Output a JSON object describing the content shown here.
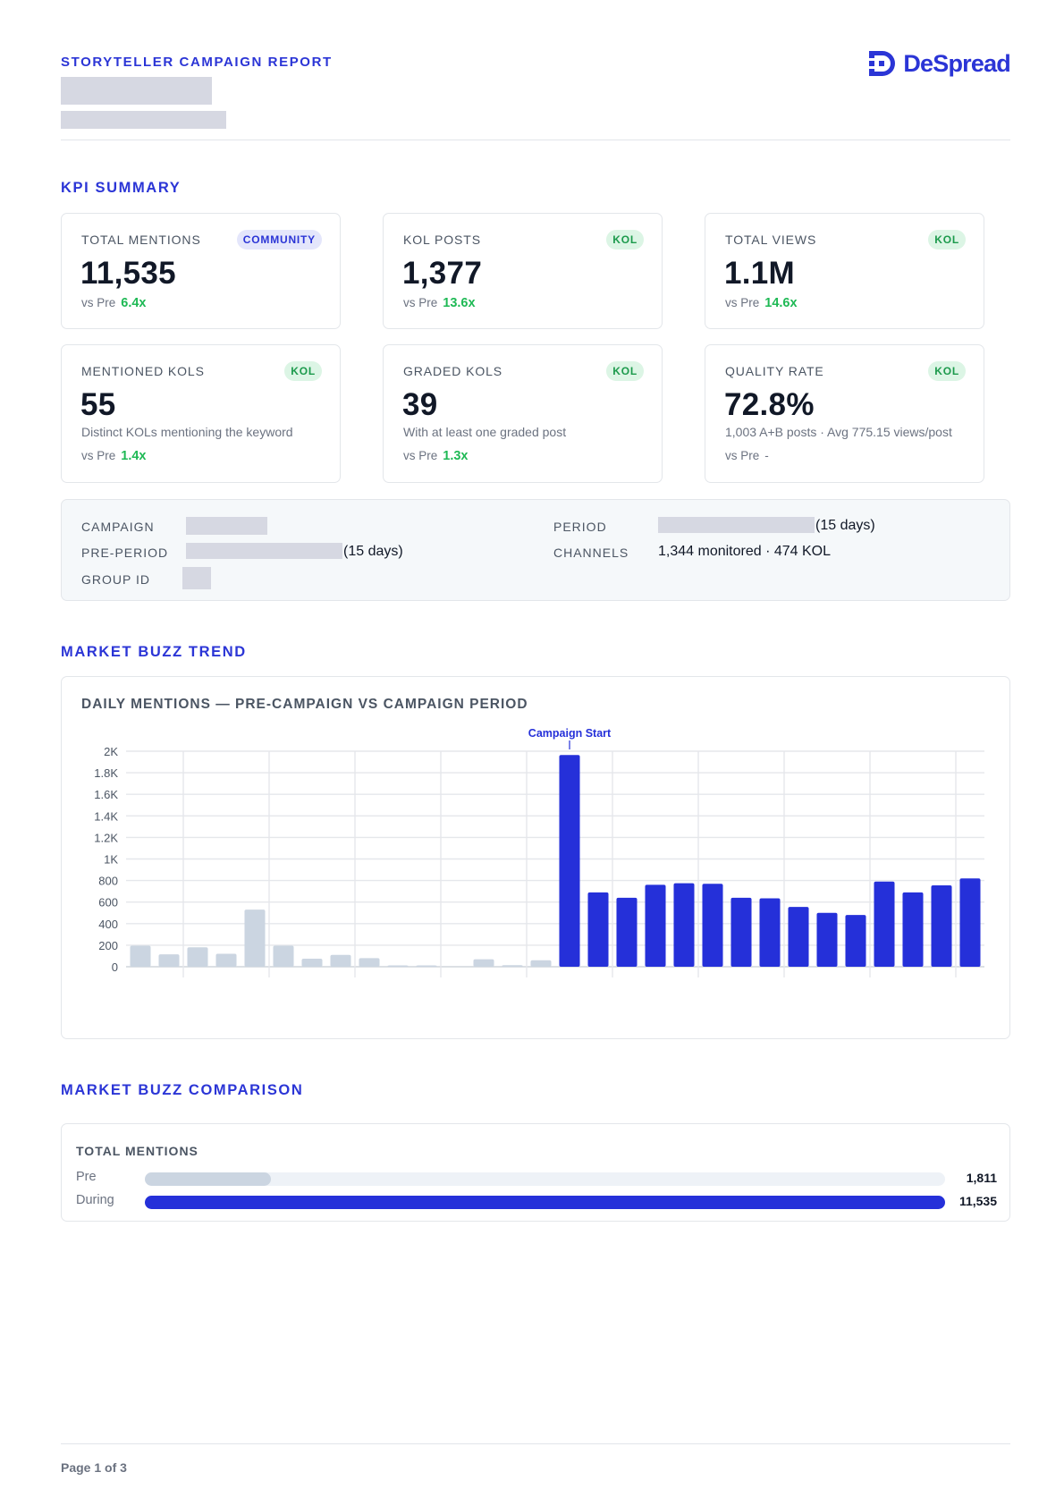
{
  "header": {
    "report_title": "STORYTELLER CAMPAIGN REPORT",
    "brand": "DeSpread"
  },
  "kpi_section_title": "KPI SUMMARY",
  "kpi_cards": [
    {
      "label": "TOTAL MENTIONS",
      "badge": "COMMUNITY",
      "value": "11,535",
      "vs_label": "vs Pre",
      "vs_value": "6.4x"
    },
    {
      "label": "KOL POSTS",
      "badge": "KOL",
      "value": "1,377",
      "vs_label": "vs Pre",
      "vs_value": "13.6x"
    },
    {
      "label": "TOTAL VIEWS",
      "badge": "KOL",
      "value": "1.1M",
      "vs_label": "vs Pre",
      "vs_value": "14.6x"
    },
    {
      "label": "MENTIONED KOLS",
      "badge": "KOL",
      "value": "55",
      "sub": "Distinct KOLs mentioning the keyword",
      "vs_label": "vs Pre",
      "vs_value": "1.4x"
    },
    {
      "label": "GRADED KOLS",
      "badge": "KOL",
      "value": "39",
      "sub": "With at least one graded post",
      "vs_label": "vs Pre",
      "vs_value": "1.3x"
    },
    {
      "label": "QUALITY RATE",
      "badge": "KOL",
      "value": "72.8%",
      "sub": "1,003 A+B posts · Avg 775.15 views/post",
      "vs_label": "vs Pre",
      "vs_value": "-"
    }
  ],
  "info": {
    "campaign_label": "CAMPAIGN",
    "pre_period_label": "PRE-PERIOD",
    "pre_period_suffix": "(15 days)",
    "group_id_label": "GROUP ID",
    "period_label": "PERIOD",
    "period_suffix": "(15 days)",
    "channels_label": "CHANNELS",
    "channels_value": "1,344 monitored · 474 KOL"
  },
  "trend_section_title": "MARKET BUZZ TREND",
  "chart_data": {
    "type": "bar",
    "title": "DAILY MENTIONS — PRE-CAMPAIGN VS CAMPAIGN PERIOD",
    "annotation": "Campaign Start",
    "ylim": [
      0,
      2000
    ],
    "yticks": [
      "0",
      "200",
      "400",
      "600",
      "800",
      "1K",
      "1.2K",
      "1.4K",
      "1.6K",
      "1.8K",
      "2K"
    ],
    "ytick_values": [
      0,
      200,
      400,
      600,
      800,
      1000,
      1200,
      1400,
      1600,
      1800,
      2000
    ],
    "grid": true,
    "series": [
      {
        "period": "pre",
        "color": "#cbd5e1",
        "values": [
          195,
          115,
          180,
          120,
          530,
          195,
          75,
          110,
          80,
          5,
          10,
          0,
          70,
          15,
          60
        ]
      },
      {
        "period": "campaign",
        "color": "#2530d9",
        "values": [
          1965,
          690,
          640,
          760,
          775,
          770,
          640,
          635,
          555,
          500,
          480,
          790,
          690,
          755,
          820
        ]
      }
    ]
  },
  "comparison_section_title": "MARKET BUZZ COMPARISON",
  "comparison": {
    "metric_label": "TOTAL MENTIONS",
    "rows": [
      {
        "label": "Pre",
        "value": 1811,
        "value_text": "1,811",
        "color": "#cbd5e1"
      },
      {
        "label": "During",
        "value": 11535,
        "value_text": "11,535",
        "color": "#2530d9"
      }
    ]
  },
  "footer": {
    "page_label": "Page 1 of 3"
  }
}
